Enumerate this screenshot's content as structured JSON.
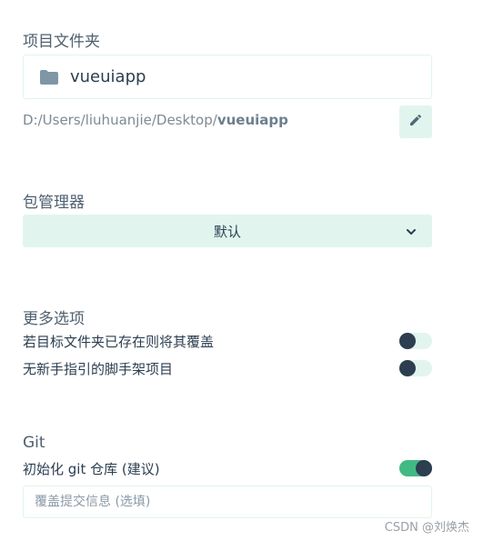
{
  "project_folder": {
    "title": "项目文件夹",
    "folder_name": "vueuiapp",
    "path_prefix": "D:/Users/liuhuanjie/Desktop/",
    "path_name": "vueuiapp",
    "icons": {
      "folder": "folder-icon",
      "edit": "pencil-icon"
    }
  },
  "package_manager": {
    "title": "包管理器",
    "selected": "默认",
    "icon": "chevron-down-icon"
  },
  "more_options": {
    "title": "更多选项",
    "items": [
      {
        "label": "若目标文件夹已存在则将其覆盖",
        "enabled": false
      },
      {
        "label": "无新手指引的脚手架项目",
        "enabled": false
      }
    ]
  },
  "git": {
    "title": "Git",
    "init_label": "初始化 git 仓库 (建议)",
    "init_enabled": true,
    "commit_placeholder": "覆盖提交信息 (选填)",
    "commit_value": ""
  },
  "colors": {
    "accent_light": "#e1f5ee",
    "accent": "#42b983",
    "dark": "#2c3e50",
    "muted": "#7c8a96"
  },
  "watermark": "CSDN @刘焕杰"
}
